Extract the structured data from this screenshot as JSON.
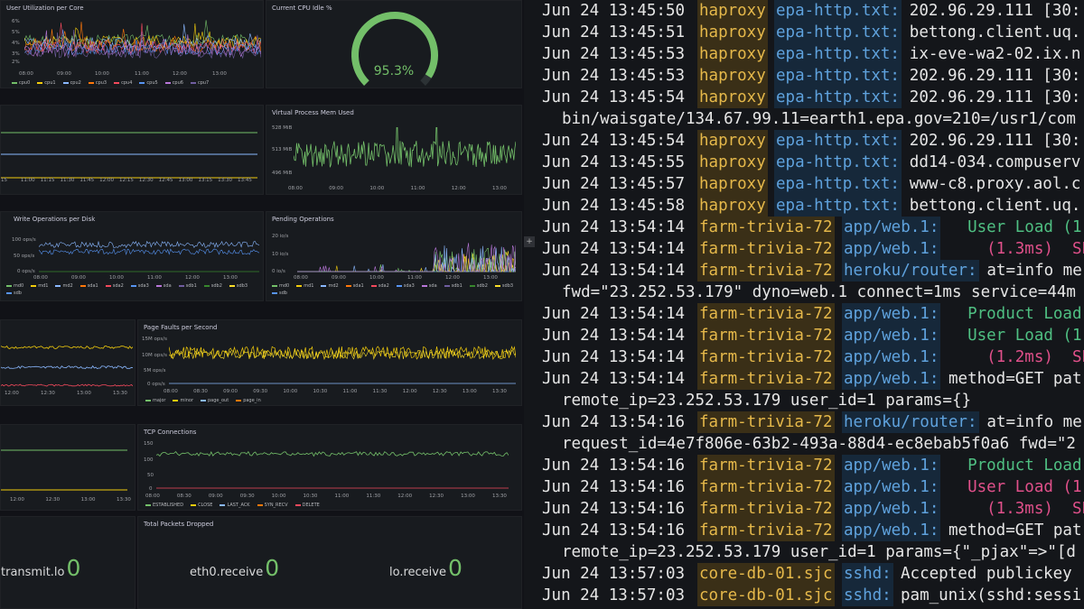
{
  "dashboard": {
    "panels": {
      "user_util": {
        "title": "User Utilization per Core",
        "y_ticks": [
          "6%",
          "5%",
          "4%",
          "3%",
          "2%"
        ],
        "x_ticks": [
          "08:00",
          "09:00",
          "10:00",
          "11:00",
          "12:00",
          "13:00"
        ],
        "legend": [
          {
            "name": "cpu0",
            "color": "#73bf69"
          },
          {
            "name": "cpu1",
            "color": "#f2cc0c"
          },
          {
            "name": "cpu2",
            "color": "#8ab8ff"
          },
          {
            "name": "cpu3",
            "color": "#ff780a"
          },
          {
            "name": "cpu4",
            "color": "#f2495c"
          },
          {
            "name": "cpu5",
            "color": "#5794f2"
          },
          {
            "name": "cpu6",
            "color": "#b877d9"
          },
          {
            "name": "cpu7",
            "color": "#705da0"
          }
        ]
      },
      "cpu_idle": {
        "title": "Current CPU Idle %",
        "value": "95.3%",
        "fraction": 0.953,
        "color": "#73bf69"
      },
      "mid_left": {
        "x_ticks": [
          "15",
          "11:00",
          "11:15",
          "11:30",
          "11:45",
          "12:00",
          "12:15",
          "12:30",
          "12:45",
          "13:00",
          "13:15",
          "13:30",
          "13:45"
        ]
      },
      "virt_mem": {
        "title": "Virtual Process Mem Used",
        "y_ticks": [
          "528 MiB",
          "513 MiB",
          "496 MiB"
        ],
        "x_ticks": [
          "08:00",
          "09:00",
          "10:00",
          "11:00",
          "12:00",
          "13:00"
        ]
      },
      "write_ops": {
        "title": "Write Operations per Disk",
        "y_ticks": [
          "100 ops/s",
          "50 ops/s",
          "0 ops/s"
        ],
        "x_ticks": [
          "08:00",
          "09:00",
          "10:00",
          "11:00",
          "12:00",
          "13:00"
        ],
        "legend": [
          {
            "name": "md0",
            "color": "#73bf69"
          },
          {
            "name": "md1",
            "color": "#f2cc0c"
          },
          {
            "name": "md2",
            "color": "#8ab8ff"
          },
          {
            "name": "sda1",
            "color": "#ff780a"
          },
          {
            "name": "sda2",
            "color": "#f2495c"
          },
          {
            "name": "sda3",
            "color": "#5794f2"
          },
          {
            "name": "sda",
            "color": "#b877d9"
          },
          {
            "name": "sdb1",
            "color": "#705da0"
          },
          {
            "name": "sdb2",
            "color": "#37872d"
          },
          {
            "name": "sdb3",
            "color": "#fade2a"
          },
          {
            "name": "sdb",
            "color": "#5794f2"
          }
        ]
      },
      "pending_ops": {
        "title": "Pending Operations",
        "y_ticks": [
          "20 io/s",
          "10 io/s",
          "0 io/s"
        ],
        "x_ticks": [
          "08:00",
          "09:00",
          "10:00",
          "11:00",
          "12:00",
          "13:00"
        ],
        "legend": [
          {
            "name": "md0",
            "color": "#73bf69"
          },
          {
            "name": "md1",
            "color": "#f2cc0c"
          },
          {
            "name": "md2",
            "color": "#8ab8ff"
          },
          {
            "name": "sda1",
            "color": "#ff780a"
          },
          {
            "name": "sda2",
            "color": "#f2495c"
          },
          {
            "name": "sda3",
            "color": "#5794f2"
          },
          {
            "name": "sda",
            "color": "#b877d9"
          },
          {
            "name": "sdb1",
            "color": "#705da0"
          },
          {
            "name": "sdb2",
            "color": "#37872d"
          },
          {
            "name": "sdb3",
            "color": "#fade2a"
          },
          {
            "name": "sdb",
            "color": "#5794f2"
          }
        ]
      },
      "left_net": {
        "x_ticks": [
          "12:00",
          "12:30",
          "13:00",
          "13:30"
        ]
      },
      "page_faults": {
        "title": "Page Faults per Second",
        "y_ticks": [
          "15M ops/s",
          "10M ops/s",
          "5M ops/s",
          "0 ops/s"
        ],
        "x_ticks": [
          "08:00",
          "08:30",
          "09:00",
          "09:30",
          "10:00",
          "10:30",
          "11:00",
          "11:30",
          "12:00",
          "12:30",
          "13:00",
          "13:30"
        ],
        "legend": [
          {
            "name": "major",
            "color": "#73bf69"
          },
          {
            "name": "minor",
            "color": "#f2cc0c"
          },
          {
            "name": "page_out",
            "color": "#8ab8ff"
          },
          {
            "name": "page_in",
            "color": "#ff780a"
          }
        ]
      },
      "left_tcp": {
        "x_ticks": [
          "12:00",
          "12:30",
          "13:00",
          "13:30"
        ]
      },
      "tcp": {
        "title": "TCP Connections",
        "y_ticks": [
          "150",
          "100",
          "50",
          "0"
        ],
        "x_ticks": [
          "08:00",
          "08:30",
          "09:00",
          "09:30",
          "10:00",
          "10:30",
          "11:00",
          "11:30",
          "12:00",
          "12:30",
          "13:00",
          "13:30"
        ],
        "legend": [
          {
            "name": "ESTABLISHED",
            "color": "#73bf69"
          },
          {
            "name": "CLOSE",
            "color": "#f2cc0c"
          },
          {
            "name": "LAST_ACK",
            "color": "#8ab8ff"
          },
          {
            "name": "SYN_RECV",
            "color": "#ff780a"
          },
          {
            "name": "DELETE",
            "color": "#f2495c"
          }
        ]
      },
      "dropped": {
        "title": "Total Packets Dropped",
        "stats": [
          {
            "label": "transmit.lo",
            "value": "0"
          },
          {
            "label": "eth0.receive",
            "value": "0"
          },
          {
            "label": "lo.receive",
            "value": "0"
          }
        ]
      }
    },
    "expander_icon": "plus-icon"
  },
  "terminal": {
    "lines": [
      {
        "date": "Jun 24 13:45:50",
        "proc": "haproxy",
        "tag": "epa-http.txt:",
        "msg": "202.96.29.111 [30:"
      },
      {
        "date": "Jun 24 13:45:51",
        "proc": "haproxy",
        "tag": "epa-http.txt:",
        "msg": "bettong.client.uq."
      },
      {
        "date": "Jun 24 13:45:53",
        "proc": "haproxy",
        "tag": "epa-http.txt:",
        "msg": "ix-eve-wa2-02.ix.n"
      },
      {
        "date": "Jun 24 13:45:53",
        "proc": "haproxy",
        "tag": "epa-http.txt:",
        "msg": "202.96.29.111 [30:"
      },
      {
        "date": "Jun 24 13:45:54",
        "proc": "haproxy",
        "tag": "epa-http.txt:",
        "msg": "202.96.29.111 [30:"
      },
      {
        "cont": "bin/waisgate/134.67.99.11=earth1.epa.gov=210=/usr1/com"
      },
      {
        "date": "Jun 24 13:45:54",
        "proc": "haproxy",
        "tag": "epa-http.txt:",
        "msg": "202.96.29.111 [30:"
      },
      {
        "date": "Jun 24 13:45:55",
        "proc": "haproxy",
        "tag": "epa-http.txt:",
        "msg": "dd14-034.compuserv"
      },
      {
        "date": "Jun 24 13:45:57",
        "proc": "haproxy",
        "tag": "epa-http.txt:",
        "msg": "www-c8.proxy.aol.c"
      },
      {
        "date": "Jun 24 13:45:58",
        "proc": "haproxy",
        "tag": "epa-http.txt:",
        "msg": "bettong.client.uq."
      },
      {
        "date": "Jun 24 13:54:14",
        "proc": "farm-trivia-72",
        "tag": "app/web.1:",
        "msg": "  User Load (1",
        "style": "green"
      },
      {
        "date": "Jun 24 13:54:14",
        "proc": "farm-trivia-72",
        "tag": "app/web.1:",
        "msg": "    (1.3ms)  SE",
        "style": "pink"
      },
      {
        "date": "Jun 24 13:54:14",
        "proc": "farm-trivia-72",
        "tag": "heroku/router:",
        "msg": "at=info me"
      },
      {
        "cont": "fwd=\"23.252.53.179\" dyno=web.1 connect=1ms service=44m"
      },
      {
        "date": "Jun 24 13:54:14",
        "proc": "farm-trivia-72",
        "tag": "app/web.1:",
        "msg": "  Product Load",
        "style": "green"
      },
      {
        "date": "Jun 24 13:54:14",
        "proc": "farm-trivia-72",
        "tag": "app/web.1:",
        "msg": "  User Load (1",
        "style": "green"
      },
      {
        "date": "Jun 24 13:54:14",
        "proc": "farm-trivia-72",
        "tag": "app/web.1:",
        "msg": "    (1.2ms)  SE",
        "style": "pink"
      },
      {
        "date": "Jun 24 13:54:14",
        "proc": "farm-trivia-72",
        "tag": "app/web.1:",
        "msg": "method=GET pat"
      },
      {
        "cont": "remote_ip=23.252.53.179 user_id=1 params={}"
      },
      {
        "date": "Jun 24 13:54:16",
        "proc": "farm-trivia-72",
        "tag": "heroku/router:",
        "msg": "at=info me"
      },
      {
        "cont": "request_id=4e7f806e-63b2-493a-88d4-ec8ebab5f0a6 fwd=\"2"
      },
      {
        "date": "Jun 24 13:54:16",
        "proc": "farm-trivia-72",
        "tag": "app/web.1:",
        "msg": "  Product Load",
        "style": "green"
      },
      {
        "date": "Jun 24 13:54:16",
        "proc": "farm-trivia-72",
        "tag": "app/web.1:",
        "msg": "  User Load (1",
        "style": "pink"
      },
      {
        "date": "Jun 24 13:54:16",
        "proc": "farm-trivia-72",
        "tag": "app/web.1:",
        "msg": "    (1.3ms)  SE",
        "style": "pink"
      },
      {
        "date": "Jun 24 13:54:16",
        "proc": "farm-trivia-72",
        "tag": "app/web.1:",
        "msg": "method=GET pat"
      },
      {
        "cont": "remote_ip=23.252.53.179 user_id=1 params={\"_pjax\"=>\"[d"
      },
      {
        "date": "Jun 24 13:57:03",
        "proc": "core-db-01.sjc",
        "tag": "sshd:",
        "msg": "Accepted publickey"
      },
      {
        "date": "Jun 24 13:57:03",
        "proc": "core-db-01.sjc",
        "tag": "sshd:",
        "msg": "pam_unix(sshd:sessi"
      }
    ]
  }
}
